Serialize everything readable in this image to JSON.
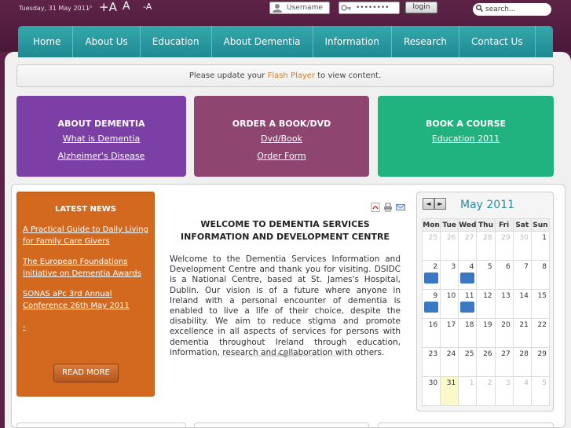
{
  "header": {
    "date": "Tuesday, 31 May 2011",
    "font_controls": [
      "+A",
      "A",
      "-A"
    ],
    "username_placeholder": "Username",
    "password_value": "••••••••",
    "login_label": "login",
    "search_placeholder": "search..."
  },
  "nav": {
    "items": [
      "Home",
      "About Us",
      "Education",
      "About Dementia",
      "Information",
      "Research",
      "Contact Us"
    ]
  },
  "flash": {
    "prefix": "Please update your ",
    "link": "Flash Player",
    "suffix": " to view content."
  },
  "features": [
    {
      "title": "ABOUT DEMENTIA",
      "links": [
        "What is Dementia",
        "Alzheimer's Disease"
      ],
      "color": "#7b3fa6"
    },
    {
      "title": "ORDER A BOOK/DVD",
      "links": [
        "Dvd/Book",
        "Order Form"
      ],
      "color": "#8e4670"
    },
    {
      "title": "BOOK A COURSE",
      "links": [
        "Education 2011"
      ],
      "color": "#20b27f"
    }
  ],
  "news": {
    "title": "LATEST NEWS",
    "items": [
      "A Practical Guide to Daily Living for Family Care Givers",
      "The European Foundations Initiative on Dementia Awards",
      "SONAS aPc 3rd Annual Conference 26th May 2011",
      "-"
    ],
    "read_more": "READ MORE"
  },
  "article": {
    "title": "WELCOME TO DEMENTIA SERVICES INFORMATION AND DEVELOPMENT CENTRE",
    "body": "Welcome to the Dementia Services Information and Development Centre and thank you for visiting. DSIDC is a National Centre, based at St. James's Hospital, Dublin. Our vision is of a future where anyone in Ireland with a personal encounter of dementia is enabled to live a life of their choice, despite the disability. We aim to reduce stigma and promote excellence in all aspects of services for persons with dementia throughout Ireland through education, information, research and collaboration with others.",
    "icons": [
      "pdf-icon",
      "print-icon",
      "email-icon"
    ]
  },
  "calendar": {
    "title": "May 2011",
    "weekdays": [
      "Mon",
      "Tue",
      "Wed",
      "Thu",
      "Fri",
      "Sat",
      "Sun"
    ],
    "weeks": [
      [
        "25",
        "26",
        "27",
        "28",
        "29",
        "30",
        "1"
      ],
      [
        "2",
        "3",
        "4",
        "5",
        "6",
        "7",
        "8"
      ],
      [
        "9",
        "10",
        "11",
        "12",
        "13",
        "14",
        "15"
      ],
      [
        "16",
        "17",
        "18",
        "19",
        "20",
        "21",
        "22"
      ],
      [
        "23",
        "24",
        "25",
        "26",
        "27",
        "28",
        "29"
      ],
      [
        "30",
        "31",
        "1",
        "2",
        "3",
        "4",
        "5"
      ]
    ],
    "prev": "◄",
    "next": "►"
  }
}
